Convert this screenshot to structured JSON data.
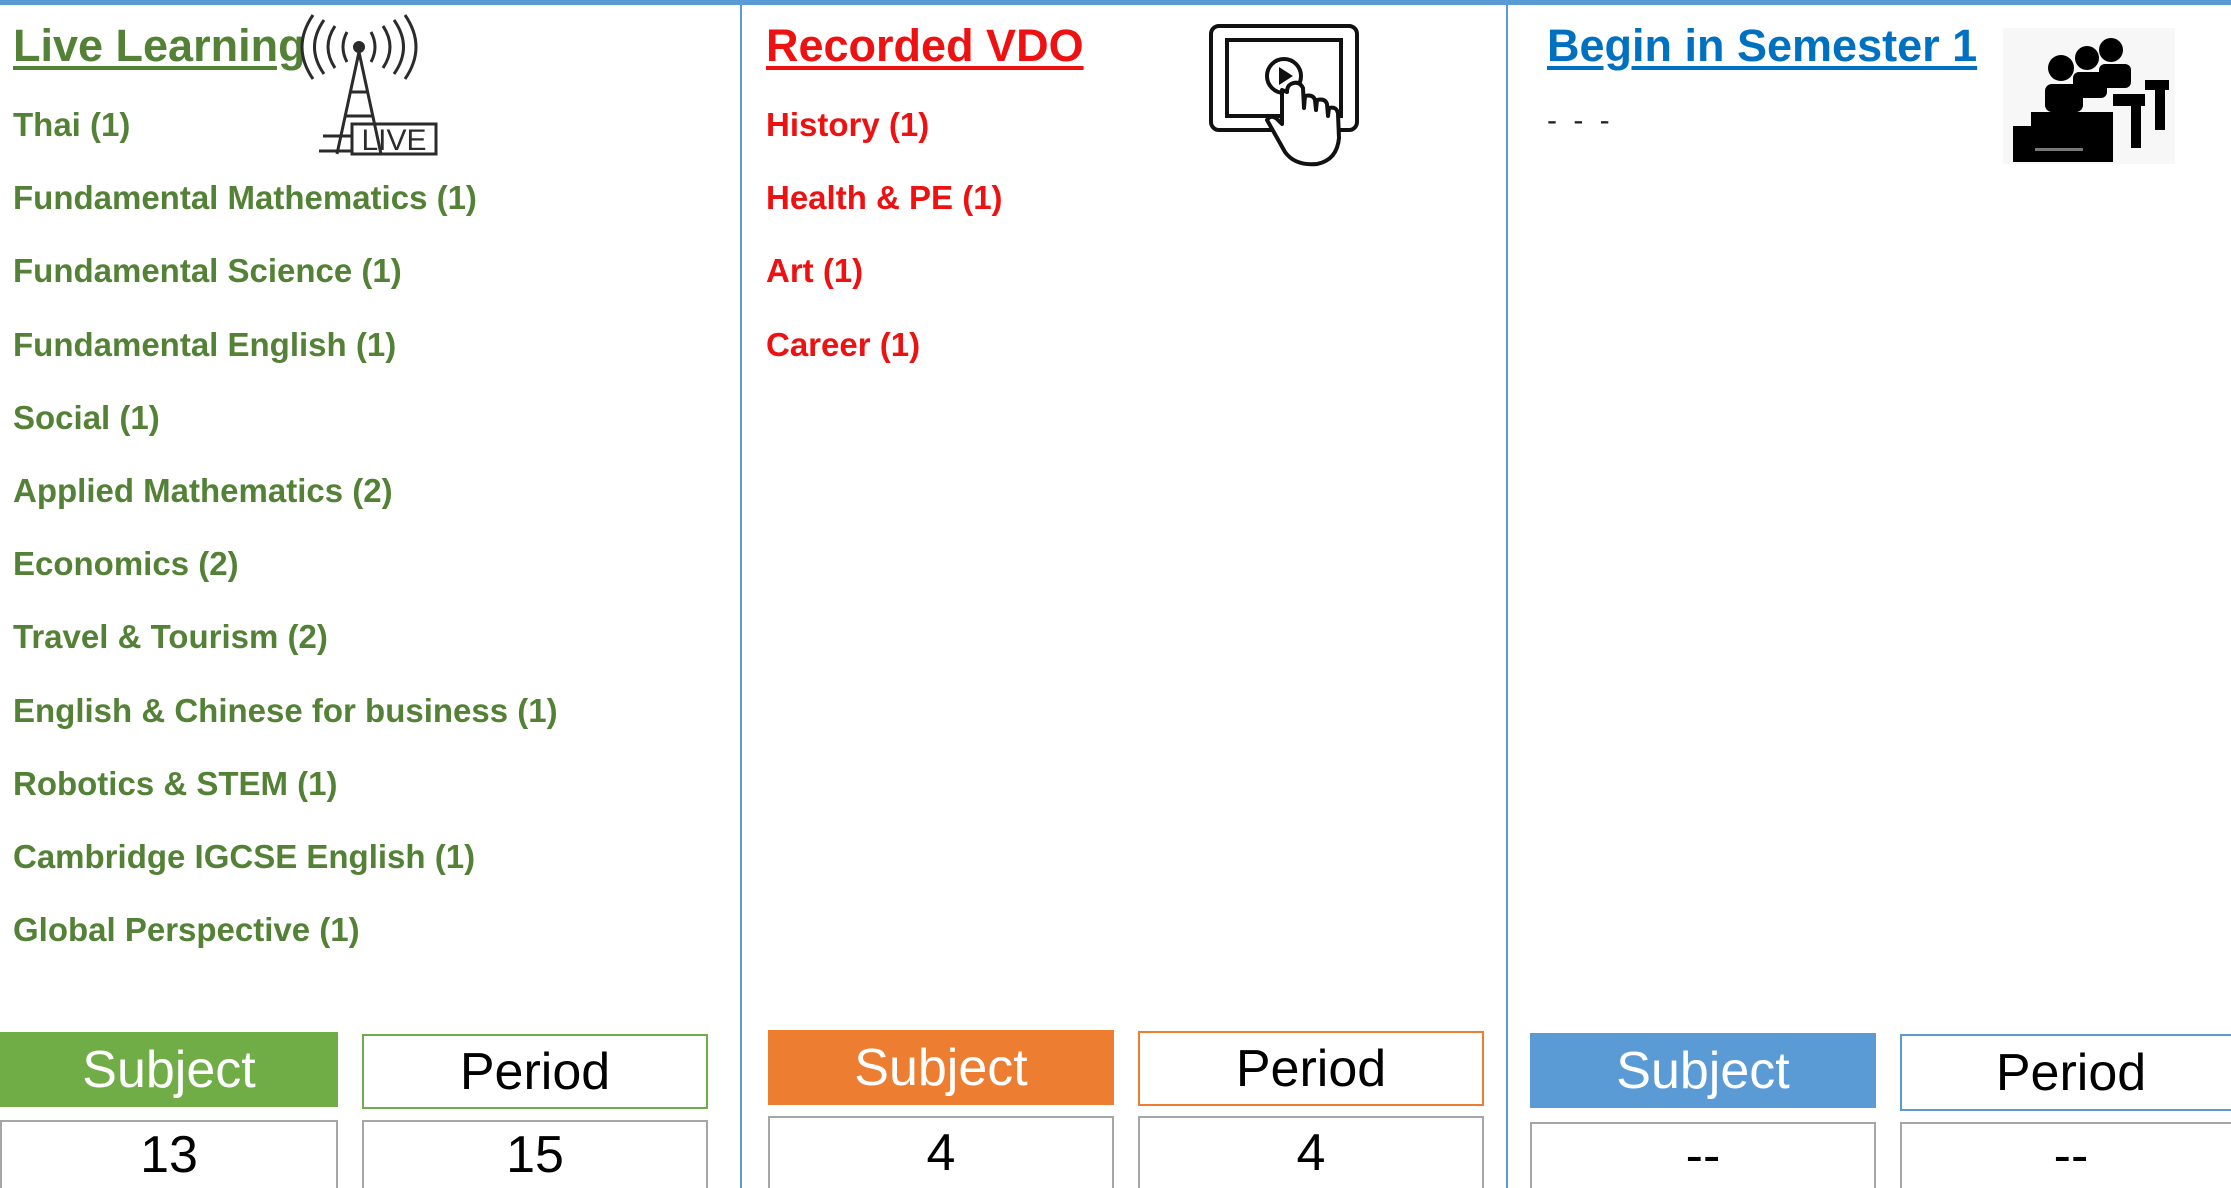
{
  "live": {
    "title": "Live Learning",
    "icon": "live-broadcast-tower-icon",
    "color": "#538135",
    "subjects": [
      "Thai (1)",
      "Fundamental Mathematics (1)",
      "Fundamental Science (1)",
      "Fundamental English (1)",
      "Social (1)",
      "Applied Mathematics (2)",
      "Economics (2)",
      "Travel & Tourism (2)",
      "English & Chinese for business (1)",
      "Robotics & STEM (1)",
      "Cambridge IGCSE English (1)",
      "Global Perspective (1)"
    ],
    "subject_label": "Subject",
    "period_label": "Period",
    "subject_count": "13",
    "period_count": "15",
    "icon_text": "LIVE"
  },
  "recorded": {
    "title": "Recorded  VDO",
    "icon": "tablet-play-touch-icon",
    "color": "#ee1111",
    "subjects": [
      "History (1)",
      "Health  & PE (1)",
      "Art (1)",
      "Career (1)"
    ],
    "subject_label": "Subject",
    "period_label": "Period",
    "subject_count": "4",
    "period_count": "4"
  },
  "semester": {
    "title": "Begin in Semester 1",
    "icon": "classroom-students-icon",
    "color": "#0070c0",
    "placeholder": "- - -",
    "subject_label": "Subject",
    "period_label": "Period",
    "subject_count": "--",
    "period_count": "--"
  },
  "colors": {
    "border": "#5b9bd5",
    "green_fill": "#70ad47",
    "orange_fill": "#ed7d31",
    "blue_fill": "#5b9bd5"
  }
}
